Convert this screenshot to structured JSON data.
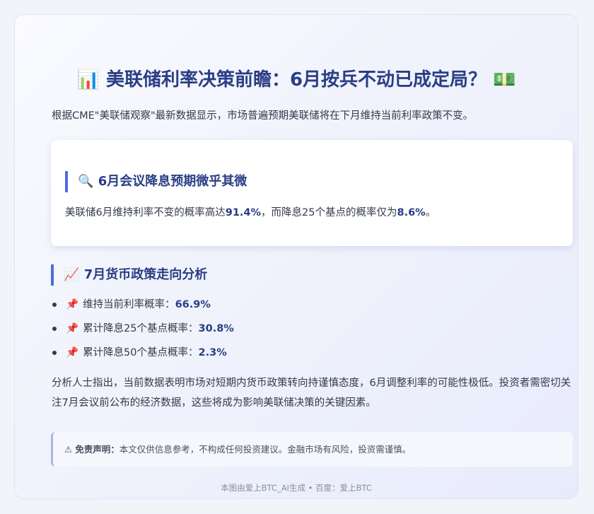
{
  "header": {
    "icon_left": "📊",
    "title": "美联储利率决策前瞻：6月按兵不动已成定局？",
    "icon_right": "💵"
  },
  "intro": "根据CME\"美联储观察\"最新数据显示，市场普遍预期美联储将在下月维持当前利率政策不变。",
  "june": {
    "icon": "🔍",
    "heading": "6月会议降息预期微乎其微",
    "text_before": "美联储6月维持利率不变的概率高达",
    "hold_pct": "91.4%",
    "text_middle": "，而降息25个基点的概率仅为",
    "cut_pct": "8.6%",
    "text_after": "。"
  },
  "july": {
    "icon": "📈",
    "heading": "7月货币政策走向分析",
    "items": [
      {
        "icon": "📌",
        "label": "维持当前利率概率：",
        "value": "66.9%"
      },
      {
        "icon": "📌",
        "label": "累计降息25个基点概率：",
        "value": "30.8%"
      },
      {
        "icon": "📌",
        "label": "累计降息50个基点概率：",
        "value": "2.3%"
      }
    ]
  },
  "analysis": "分析人士指出，当前数据表明市场对短期内货币政策转向持谨慎态度，6月调整利率的可能性极低。投资者需密切关注7月会议前公布的经济数据，这些将成为影响美联储决策的关键因素。",
  "disclaimer": {
    "icon": "⚠",
    "label": "免责声明：",
    "text": "本文仅供信息参考，不构成任何投资建议。金融市场有风险，投资需谨慎。"
  },
  "footer": "本图由爱上BTC_AI生成 • 百度：爱上BTC",
  "colors": {
    "accent": "#4d6be0",
    "heading": "#2a3e85",
    "body_text": "#333a4a"
  }
}
